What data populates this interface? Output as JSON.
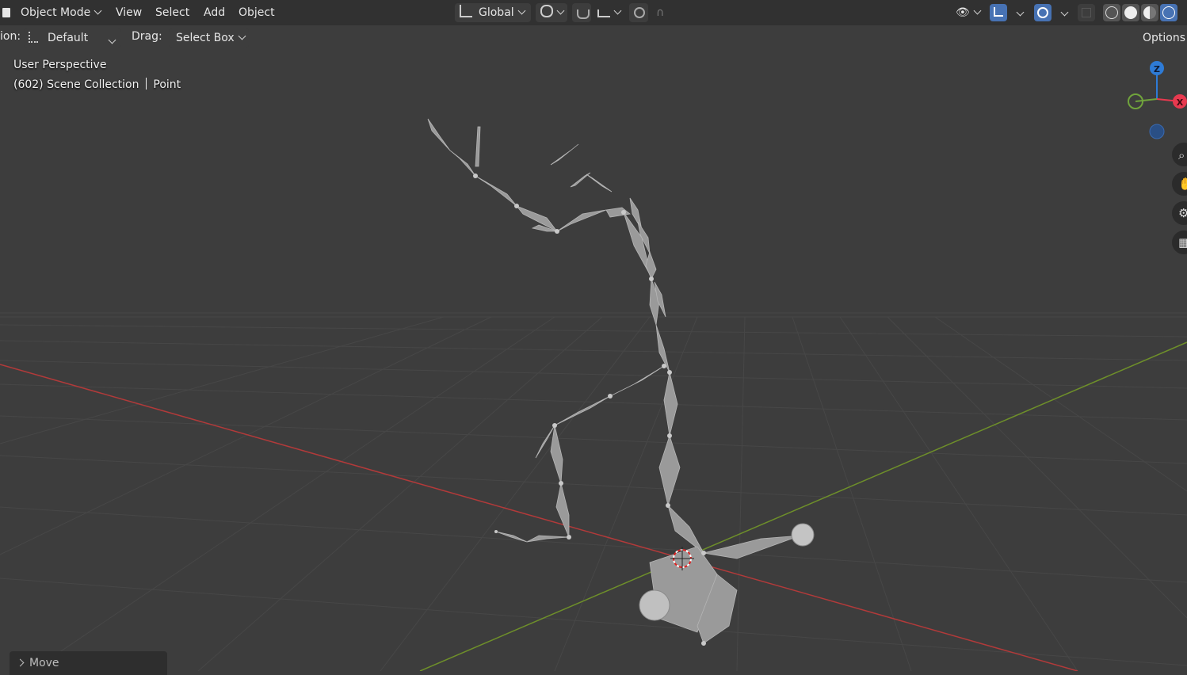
{
  "header": {
    "mode": "Object Mode",
    "menus": [
      "View",
      "Select",
      "Add",
      "Object"
    ],
    "orientation": "Global"
  },
  "tool_settings": {
    "orientation_label_partial": "ion:",
    "orientation_value": "Default",
    "drag_label": "Drag:",
    "drag_value": "Select Box",
    "options_label": "Options"
  },
  "viewport_info": {
    "view_name": "User Perspective",
    "frame": "(602)",
    "collection": "Scene Collection",
    "active_object": "Point"
  },
  "gizmo": {
    "z_label": "Z",
    "x_label": "X",
    "colors": {
      "x": "#e8394f",
      "y": "#70a43c",
      "z": "#2e7bd6"
    }
  },
  "last_operator": {
    "label": "Move"
  },
  "colors": {
    "grid_x_axis": "#b23a3a",
    "grid_y_axis": "#6e8f2a",
    "bone": "#9a9a9a"
  }
}
